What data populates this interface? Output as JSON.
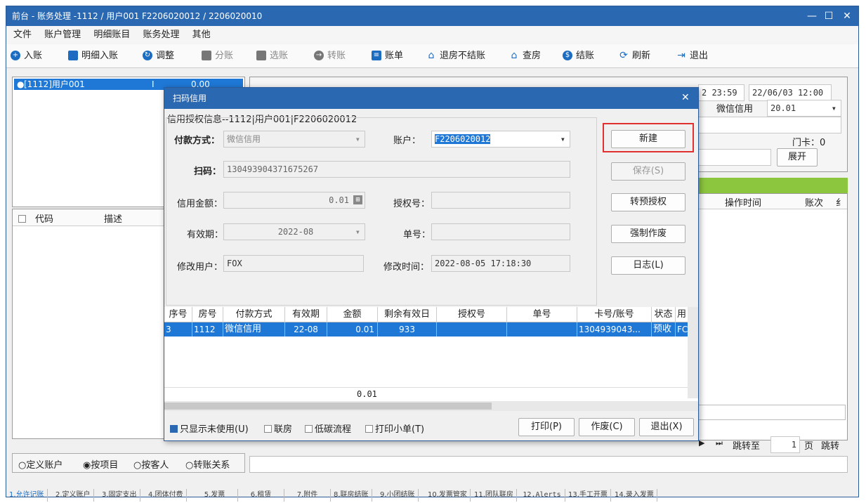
{
  "window": {
    "title": "前台 - 账务处理 -1112 / 用户001 F2206020012 / 2206020010"
  },
  "menu": [
    "文件",
    "账户管理",
    "明细账目",
    "账务处理",
    "其他"
  ],
  "toolbar": {
    "items": [
      {
        "label": "入账",
        "icon": "plus-circle-icon",
        "enabled": true
      },
      {
        "label": "明细入账",
        "icon": "card-icon",
        "enabled": true
      },
      {
        "label": "调整",
        "icon": "adjust-icon",
        "enabled": true
      },
      {
        "label": "分账",
        "icon": "split-icon",
        "enabled": false
      },
      {
        "label": "选账",
        "icon": "select-icon",
        "enabled": false
      },
      {
        "label": "转账",
        "icon": "transfer-icon",
        "enabled": false
      },
      {
        "label": "账单",
        "icon": "bill-icon",
        "enabled": true
      },
      {
        "label": "退房不结账",
        "icon": "checkout-icon",
        "enabled": true
      },
      {
        "label": "查房",
        "icon": "house-icon",
        "enabled": true
      },
      {
        "label": "结账",
        "icon": "coins-icon",
        "enabled": true
      },
      {
        "label": "刷新",
        "icon": "refresh-icon",
        "enabled": true
      },
      {
        "label": "退出",
        "icon": "exit-icon",
        "enabled": true
      }
    ]
  },
  "left": {
    "account_item": "[1112]用户001",
    "account_flag": "I",
    "account_amount": "0.00",
    "grid_headers": [
      "代码",
      "描述"
    ],
    "radios": [
      {
        "label": "定义账户",
        "checked": false
      },
      {
        "label": "按项目",
        "checked": true
      },
      {
        "label": "按客人",
        "checked": false
      },
      {
        "label": "转账关系",
        "checked": false
      }
    ]
  },
  "right": {
    "time_a": "2 23:59",
    "time_b": "22/06/03 12:00",
    "pay_label": "微信信用",
    "pay_value": "20.01",
    "door_card": "门卡：0",
    "expand": "展开",
    "col_op_time": "操作时间",
    "col_times": "账次",
    "col_extra": "纟",
    "jump_label": "跳转至",
    "page_num": "1",
    "page_unit": "页",
    "jump_btn": "跳转"
  },
  "dialog": {
    "title": "扫码信用",
    "group_title": "信用授权信息--1112|用户001|F2206020012",
    "pay_method_label": "付款方式：",
    "pay_method_value": "微信信用",
    "account_label": "账户：",
    "account_value": "F2206020012",
    "scan_label": "扫码：",
    "scan_value": "130493904371675267",
    "credit_label": "信用金额：",
    "credit_value": "0.01",
    "auth_label": "授权号：",
    "auth_value": "",
    "valid_label": "有效期：",
    "valid_value": "2022-08",
    "order_label": "单号：",
    "order_value": "",
    "user_label": "修改用户：",
    "user_value": "FOX",
    "time_label": "修改时间：",
    "time_value": "2022-08-05 17:18:30",
    "buttons": {
      "new": "新建",
      "save": "保存(S)",
      "pre_auth": "转预授权",
      "void_force": "强制作废",
      "log": "日志(L)"
    },
    "grid": {
      "headers": [
        "序号",
        "房号",
        "付款方式",
        "有效期",
        "金额",
        "剩余有效日",
        "授权号",
        "单号",
        "卡号/账号",
        "状态",
        "用"
      ],
      "rows": [
        [
          "3",
          "1112",
          "微信信用",
          "22-08",
          "0.01",
          "933",
          "",
          "",
          "1304939043...",
          "预收",
          "FC"
        ]
      ],
      "total": "0.01"
    },
    "options": [
      {
        "label": "只显示未使用(U)",
        "checked": true
      },
      {
        "label": "联房",
        "checked": false
      },
      {
        "label": "低碳流程",
        "checked": false
      },
      {
        "label": "打印小单(T)",
        "checked": false
      }
    ],
    "bottom_buttons": {
      "print": "打印(P)",
      "void": "作废(C)",
      "exit": "退出(X)"
    }
  },
  "status_tabs": [
    "1.允许记账",
    "2.定义账户",
    "3.固定支出",
    "4.团体付费",
    "5.发票",
    "6.租赁",
    "7.附件",
    "8.联房结账",
    "9.小团结账",
    "10.发票管家",
    "11.团队联房",
    "12.Alerts",
    "13.手工开票",
    "14.录入发票"
  ],
  "colors": {
    "title": "#2b68b2",
    "selection": "#1f78d6",
    "highlight": "#e03030",
    "green_bar": "#8cc63f"
  }
}
